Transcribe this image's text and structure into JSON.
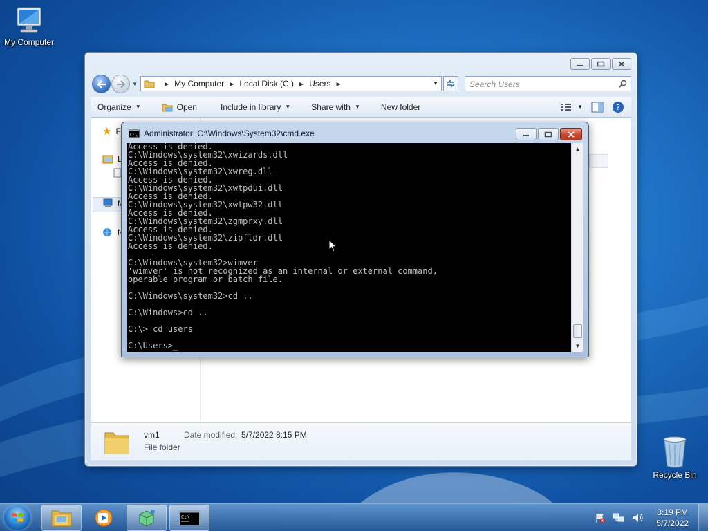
{
  "desktop": {
    "icons": [
      {
        "label": "My Computer"
      },
      {
        "label": "Recycle Bin"
      }
    ]
  },
  "explorer": {
    "breadcrumb": [
      "My Computer",
      "Local Disk (C:)",
      "Users"
    ],
    "search_placeholder": "Search Users",
    "toolbar": {
      "organize": "Organize",
      "open": "Open",
      "include_in_library": "Include in library",
      "share_with": "Share with",
      "new_folder": "New folder"
    },
    "nav_pane_partial": [
      "F",
      "L",
      "M",
      "N"
    ],
    "details": {
      "name": "vm1",
      "type": "File folder",
      "date_label": "Date modified:",
      "date_value": "5/7/2022 8:15 PM"
    }
  },
  "cmd": {
    "title": "Administrator: C:\\Windows\\System32\\cmd.exe",
    "lines": [
      "Access is denied.",
      "C:\\Windows\\system32\\xwizards.dll",
      "Access is denied.",
      "C:\\Windows\\system32\\xwreg.dll",
      "Access is denied.",
      "C:\\Windows\\system32\\xwtpdui.dll",
      "Access is denied.",
      "C:\\Windows\\system32\\xwtpw32.dll",
      "Access is denied.",
      "C:\\Windows\\system32\\zgmprxy.dll",
      "Access is denied.",
      "C:\\Windows\\system32\\zipfldr.dll",
      "Access is denied.",
      "",
      "C:\\Windows\\system32>wimver",
      "'wimver' is not recognized as an internal or external command,",
      "operable program or batch file.",
      "",
      "C:\\Windows\\system32>cd ..",
      "",
      "C:\\Windows>cd ..",
      "",
      "C:\\> cd users",
      "",
      "C:\\Users>"
    ]
  },
  "taskbar": {
    "time": "8:19 PM",
    "date": "5/7/2022"
  },
  "colors": {
    "accent": "#1f73c6",
    "console_bg": "#000000",
    "console_fg": "#c0c0c0"
  }
}
